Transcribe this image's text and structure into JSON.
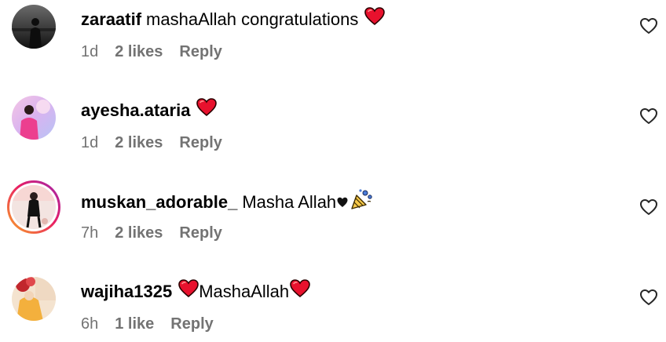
{
  "comments": [
    {
      "username": "zaraatif",
      "text": "mashaAllah congratulations",
      "time": "1d",
      "likes": "2 likes",
      "reply": "Reply",
      "emoji_after": [
        "red-heart"
      ]
    },
    {
      "username": "ayesha.ataria",
      "text": "",
      "time": "1d",
      "likes": "2 likes",
      "reply": "Reply",
      "emoji_after": [
        "red-heart"
      ]
    },
    {
      "username": "muskan_adorable_",
      "text": "Masha Allah",
      "time": "7h",
      "likes": "2 likes",
      "reply": "Reply",
      "emoji_after": [
        "black-heart",
        "party-popper"
      ],
      "story_ring": true
    },
    {
      "username": "wajiha1325",
      "text": "MashaAllah",
      "time": "6h",
      "likes": "1 like",
      "reply": "Reply",
      "emoji_before": [
        "red-heart"
      ],
      "emoji_after": [
        "red-heart"
      ]
    }
  ],
  "colors": {
    "meta_gray": "#737373",
    "heart_red": "#e8112d",
    "story_ring_start": "#f9a825",
    "story_ring_end": "#9c27b0"
  },
  "icons": {
    "like": "heart-outline-icon"
  }
}
